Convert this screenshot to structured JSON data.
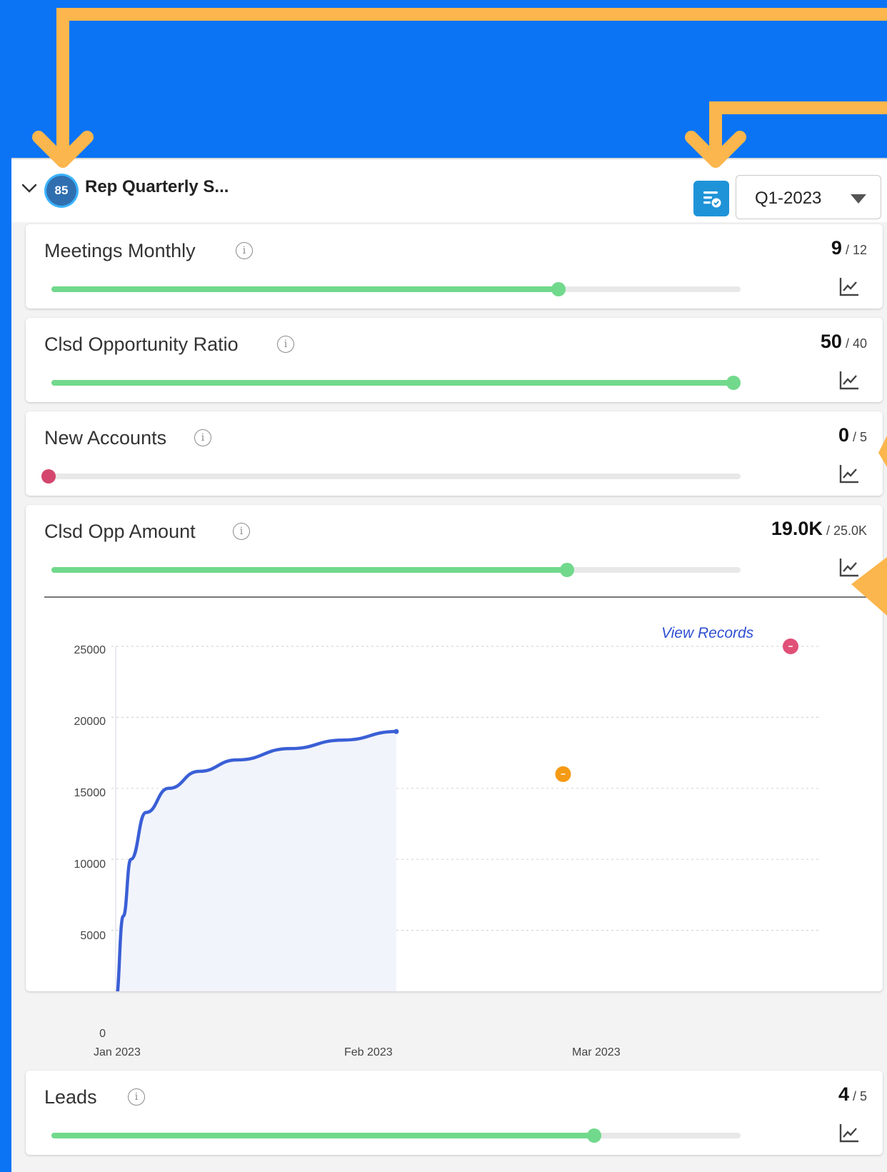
{
  "header": {
    "score": "85",
    "title": "Rep Quarterly S...",
    "period": "Q1-2023"
  },
  "metrics": [
    {
      "name": "Meetings Monthly",
      "current": "9",
      "target": "12",
      "progress": 0.75,
      "status": "good"
    },
    {
      "name": "Clsd Opportunity Ratio",
      "current": "50",
      "target": "40",
      "progress": 1.0,
      "status": "good"
    },
    {
      "name": "New Accounts",
      "current": "0",
      "target": "5",
      "progress": 0.0,
      "status": "bad"
    },
    {
      "name": "Clsd Opp Amount",
      "current": "19.0K",
      "target": "25.0K",
      "progress": 0.76,
      "status": "good"
    },
    {
      "name": "Leads",
      "current": "4",
      "target": "5",
      "progress": 0.8,
      "status": "good"
    }
  ],
  "expanded_chart": {
    "link_label": "View Records",
    "chart_data": {
      "type": "area",
      "x_tick_labels": [
        "Jan 2023",
        "Feb 2023",
        "Mar 2023"
      ],
      "y_ticks": [
        0,
        5000,
        10000,
        15000,
        20000,
        25000
      ],
      "ylim": [
        0,
        25000
      ],
      "grid": true,
      "series": [
        {
          "x": [
            "2023-01-01",
            "2023-01-02",
            "2023-01-03",
            "2023-01-05",
            "2023-01-08",
            "2023-01-12",
            "2023-01-17",
            "2023-01-24",
            "2023-01-31",
            "2023-02-07"
          ],
          "values": [
            0,
            6000,
            10000,
            13300,
            15000,
            16200,
            17000,
            17800,
            18400,
            19000
          ]
        }
      ],
      "markers": [
        {
          "x": "2023-03-01",
          "value": 16000,
          "color": "#f59a14"
        },
        {
          "x": "2023-03-31",
          "value": 25000,
          "color": "#e05077"
        }
      ]
    }
  },
  "colors": {
    "background": "#0a74f5",
    "annotation": "#fbb64d",
    "progress_good": "#71d98c",
    "progress_bad": "#d4466d",
    "line": "#3a5fd6",
    "area": "#f2f4fb"
  },
  "icons": {
    "collapse": "chevron-down-icon",
    "info": "info-icon",
    "trend": "line-chart-icon",
    "schedule": "schedule-check-icon",
    "dropdown": "caret-down-icon"
  }
}
